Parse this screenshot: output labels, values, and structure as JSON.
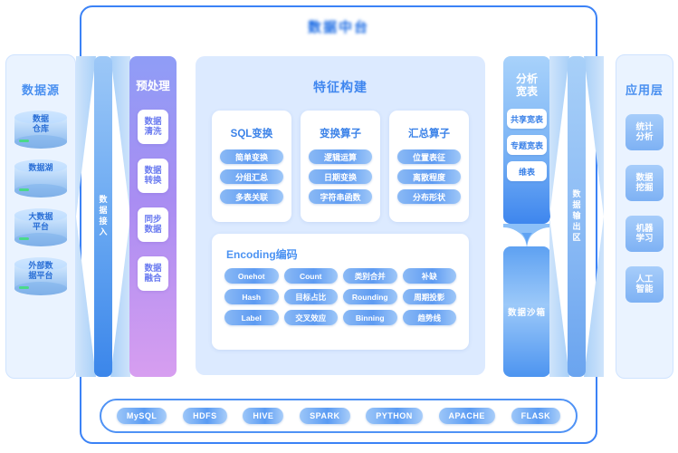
{
  "platform": {
    "title": "数据中台"
  },
  "data_source": {
    "title": "数据源",
    "items": [
      {
        "label": "数据\n仓库"
      },
      {
        "label": "数据湖"
      },
      {
        "label": "大数据\n平台"
      },
      {
        "label": "外部数\n据平台"
      }
    ]
  },
  "data_intake": {
    "label": "数据接入"
  },
  "preprocess": {
    "title": "预处理",
    "items": [
      "数据\n清洗",
      "数据\n转换",
      "同步\n数据",
      "数据\n融合"
    ]
  },
  "feature": {
    "title": "特征构建",
    "cards": [
      {
        "title": "SQL变换",
        "pills": [
          "简单变换",
          "分组汇总",
          "多表关联"
        ]
      },
      {
        "title": "变换算子",
        "pills": [
          "逻辑运算",
          "日期变换",
          "字符串函数"
        ]
      },
      {
        "title": "汇总算子",
        "pills": [
          "位置表征",
          "离散程度",
          "分布形状"
        ]
      }
    ],
    "encoding": {
      "title": "Encoding编码",
      "pills": [
        "Onehot",
        "Count",
        "类别合并",
        "补缺",
        "Hash",
        "目标占比",
        "Rounding",
        "周期投影",
        "Label",
        "交叉效应",
        "Binning",
        "趋势线"
      ]
    }
  },
  "wide_table": {
    "title": "分析\n宽表",
    "items": [
      "共享宽表",
      "专题宽表",
      "维表"
    ]
  },
  "sandbox": {
    "label": "数据沙箱"
  },
  "data_output": {
    "label": "数据输出区"
  },
  "app_layer": {
    "title": "应用层",
    "items": [
      "统计\n分析",
      "数据\n挖掘",
      "机器\n学习",
      "人工\n智能"
    ]
  },
  "tech_stack": {
    "items": [
      "MySQL",
      "HDFS",
      "HIVE",
      "SPARK",
      "PYTHON",
      "APACHE",
      "FLASK"
    ]
  },
  "colors": {
    "frame_blue": "#3b82f6",
    "panel_bg": "#eaf3ff",
    "feature_bg": "#dceaff",
    "pill_blue": "#5e9bf2",
    "preprocess_purple": "#a98df2",
    "title_blue": "#4a90f0"
  }
}
